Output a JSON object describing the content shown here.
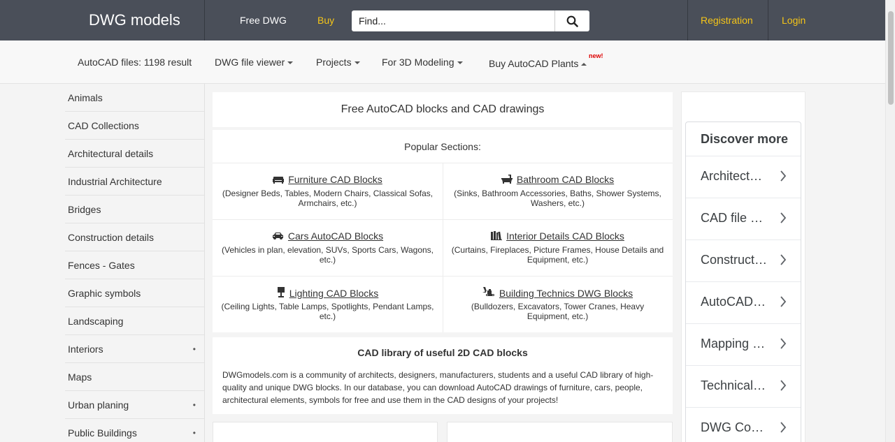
{
  "header": {
    "brand": "DWG models",
    "nav_free": "Free DWG",
    "nav_buy": "Buy",
    "search_placeholder": "Find...",
    "registration": "Registration",
    "login": "Login",
    "accent_color": "#f5c518"
  },
  "subnav": {
    "result_count": "AutoCAD files: 1198 result",
    "viewer": "DWG file viewer",
    "projects": "Projects",
    "modeling": "For 3D Modeling",
    "plants": "Buy AutoCAD Plants",
    "new_badge": "new!"
  },
  "sidebar": {
    "items": [
      {
        "label": "Animals",
        "dot": ""
      },
      {
        "label": "CAD Collections",
        "dot": ""
      },
      {
        "label": "Architectural details",
        "dot": ""
      },
      {
        "label": "Industrial Architecture",
        "dot": ""
      },
      {
        "label": "Bridges",
        "dot": ""
      },
      {
        "label": "Construction details",
        "dot": ""
      },
      {
        "label": "Fences - Gates",
        "dot": ""
      },
      {
        "label": "Graphic symbols",
        "dot": ""
      },
      {
        "label": "Landscaping",
        "dot": ""
      },
      {
        "label": "Interiors",
        "dot": "•"
      },
      {
        "label": "Maps",
        "dot": ""
      },
      {
        "label": "Urban planing",
        "dot": "•"
      },
      {
        "label": "Public Buildings",
        "dot": "•"
      }
    ]
  },
  "main": {
    "title": "Free AutoCAD blocks and CAD drawings",
    "popular_heading": "Popular Sections:",
    "sections": [
      {
        "icon": "sofa-icon",
        "title": "Furniture CAD Blocks",
        "desc": "(Designer Beds, Tables, Modern Chairs, Classical Sofas, Armchairs, etc.)"
      },
      {
        "icon": "bathtub-icon",
        "title": "Bathroom CAD Blocks",
        "desc": "(Sinks, Bathroom Accessories, Baths, Shower Systems, Washers, etc.)"
      },
      {
        "icon": "car-icon",
        "title": "Cars AutoCAD Blocks",
        "desc": "(Vehicles in plan, elevation, SUVs, Sports Cars, Wagons, etc.)"
      },
      {
        "icon": "books-icon",
        "title": "Interior Details CAD Blocks",
        "desc": "(Curtains, Fireplaces, Picture Frames, House Details and Equipment, etc.)"
      },
      {
        "icon": "lamp-icon",
        "title": "Lighting CAD Blocks",
        "desc": "(Ceiling Lights, Table Lamps, Spotlights, Pendant Lamps, etc.)"
      },
      {
        "icon": "excavator-icon",
        "title": "Building Technics DWG Blocks",
        "desc": "(Bulldozers, Excavators, Tower Cranes, Heavy Equipment, etc.)"
      }
    ],
    "library_title": "CAD library of useful 2D CAD blocks",
    "library_text": "DWGmodels.com is a community of architects, designers, manufacturers, students and a useful CAD library of high-quality and unique DWG blocks. In our database, you can download AutoCAD drawings of furniture, cars, people, architectural elements, symbols for free and use them in the CAD designs of your projects!"
  },
  "discover": {
    "heading": "Discover more",
    "items": [
      "Architectural drawings",
      "CAD file converter",
      "Construction drawings",
      "AutoCAD software",
      "Mapping software",
      "Technical drawing",
      "DWG Converter"
    ]
  }
}
